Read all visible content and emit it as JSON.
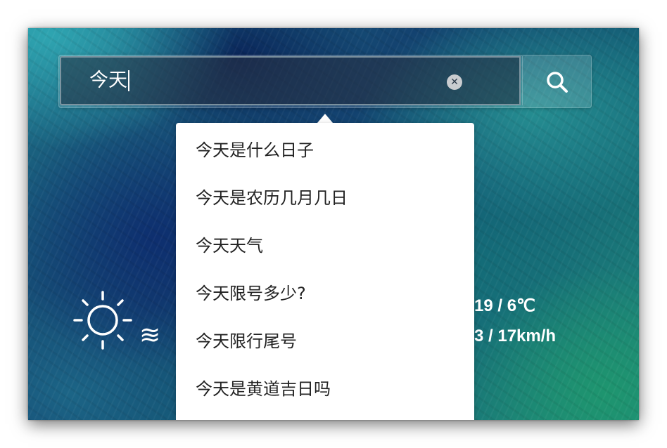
{
  "search": {
    "query": "今天",
    "clear_icon": "clear-x-icon",
    "search_icon": "magnifier-icon"
  },
  "suggestions": [
    "今天是什么日子",
    "今天是农历几月几日",
    "今天天气",
    "今天限号多少?",
    "今天限行尾号",
    "今天是黄道吉日吗"
  ],
  "weather": {
    "condition_icon": "sun-icon",
    "wind_icon": "wind-waves-icon",
    "temperature_visible": "19 / 6℃",
    "wind_visible": "3 / 17km/h"
  },
  "colors": {
    "dropdown_bg": "#ffffff",
    "suggestion_text": "#222222",
    "overlay_text": "#ffffff"
  }
}
